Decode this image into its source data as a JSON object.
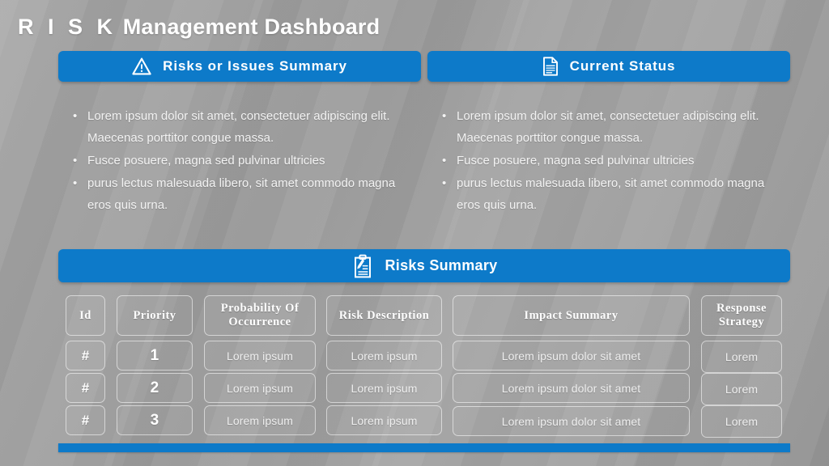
{
  "page_title": {
    "emphasis": "R I S K",
    "rest": " Management Dashboard"
  },
  "accent_color": "#0d7ac9",
  "banners": {
    "risks_issues": {
      "label": "Risks or Issues Summary",
      "icon": "warning-triangle-icon"
    },
    "current_status": {
      "label": "Current Status",
      "icon": "document-icon"
    },
    "risks_summary": {
      "label": "Risks Summary",
      "icon": "clipboard-pencil-icon"
    }
  },
  "bullets_left": [
    "Lorem ipsum dolor sit amet, consectetuer adipiscing elit. Maecenas porttitor congue massa.",
    "Fusce posuere, magna sed pulvinar ultricies",
    "purus lectus malesuada libero, sit amet commodo magna eros quis urna."
  ],
  "bullets_right": [
    "Lorem ipsum dolor sit amet, consectetuer adipiscing elit. Maecenas porttitor congue massa.",
    "Fusce posuere, magna sed pulvinar ultricies",
    "purus lectus malesuada libero, sit amet commodo magna eros quis urna."
  ],
  "table": {
    "headers": [
      "Id",
      "Priority",
      "Probability Of Occurrence",
      "Risk Description",
      "Impact Summary",
      "Response Strategy"
    ],
    "rows": [
      [
        "#",
        "1",
        "Lorem ipsum",
        "Lorem ipsum",
        "Lorem ipsum dolor sit amet",
        "Lorem"
      ],
      [
        "#",
        "2",
        "Lorem ipsum",
        "Lorem ipsum",
        "Lorem ipsum dolor sit amet",
        "Lorem"
      ],
      [
        "#",
        "3",
        "Lorem ipsum",
        "Lorem ipsum",
        "Lorem ipsum dolor sit amet",
        "Lorem"
      ]
    ]
  }
}
